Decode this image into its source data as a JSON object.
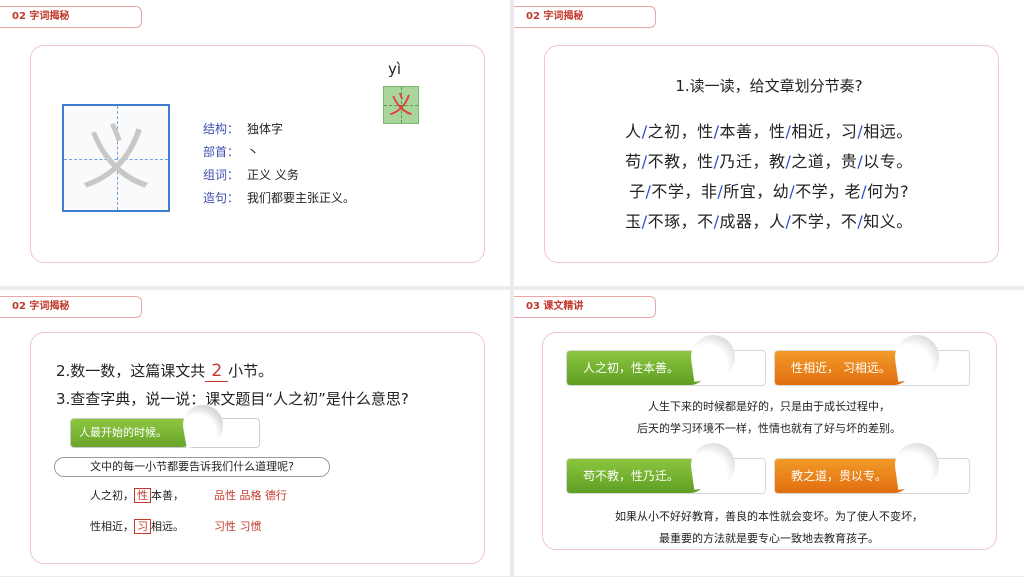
{
  "slide1": {
    "tag": "02 字词揭秘",
    "big_char": "义",
    "info": [
      {
        "key": "结构：",
        "value": "独体字"
      },
      {
        "key": "部首：",
        "value": "丶"
      },
      {
        "key": "组词：",
        "value": "正义  义务"
      },
      {
        "key": "造句：",
        "value": "我们都要主张正义。"
      }
    ],
    "pinyin": "yì",
    "small_char": "义"
  },
  "slide2": {
    "tag": "02 字词揭秘",
    "question": "1.读一读，给文章划分节奏?",
    "poem": [
      [
        "人",
        "/",
        "之初，性",
        "/",
        "本善，性",
        "/",
        "相近，习",
        "/",
        "相远。"
      ],
      [
        "苟",
        "/",
        "不教，性",
        "/",
        "乃迁，教",
        "/",
        "之道，贵",
        "/",
        "以专。"
      ],
      [
        "子",
        "/",
        "不学，非",
        "/",
        "所宜，幼",
        "/",
        "不学，老",
        "/",
        "何为?"
      ],
      [
        "玉",
        "/",
        "不琢，不",
        "/",
        "成器，人",
        "/",
        "不学，不",
        "/",
        "知义。"
      ]
    ]
  },
  "slide3": {
    "tag": "02 字词揭秘",
    "q2_pre": "2.数一数，这篇课文共",
    "q2_answer": "2",
    "q2_post": "小节。",
    "q3": "3.查查字典，说一说：课文题目“人之初”是什么意思?",
    "answer": "人最开始的时候。",
    "q4": "文中的每一小节都要告诉我们什么道理呢?",
    "row1_pre": "人之初，",
    "row1_box": "性",
    "row1_post": "本善，",
    "row1_words": "品性 品格 德行",
    "row2_pre": "性相近，",
    "row2_box": "习",
    "row2_post": "相远。",
    "row2_words": "习性  习惯"
  },
  "slide4": {
    "tag": "03 课文精讲",
    "b1": "人之初，性本善。",
    "b2": "性相近，  习相远。",
    "d1_1": "人生下来的时候都是好的，只是由于成长过程中，",
    "d1_2": "后天的学习环境不一样，性情也就有了好与坏的差别。",
    "b3": "苟不教，性乃迁。",
    "b4": "教之道，贵以专。",
    "d2_1": "如果从小不好好教育，善良的本性就会变坏。为了使人不变坏，",
    "d2_2": "最重要的方法就是要专心一致地去教育孩子。",
    "colors": {
      "green": "#7ab737",
      "orange": "#ef8a1f"
    }
  }
}
